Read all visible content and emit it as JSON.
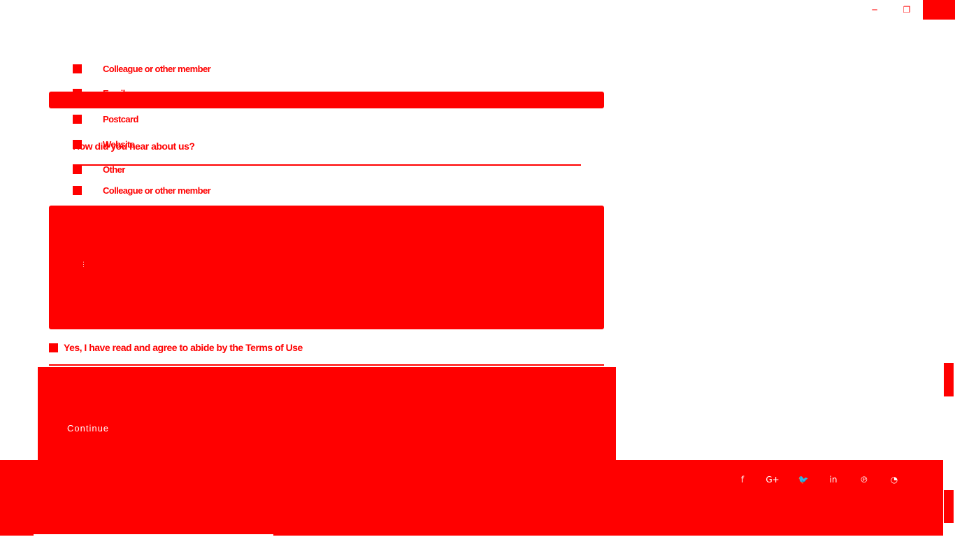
{
  "window": {
    "minimize_glyph": "─",
    "restore_glyph": "❐"
  },
  "referral_options_top": [
    {
      "label": "Colleague or other member"
    },
    {
      "label": "Email"
    },
    {
      "label": "Postcard"
    },
    {
      "label": "Website"
    },
    {
      "label": "Other"
    },
    {
      "label": "Colleague or other member"
    }
  ],
  "question": "How did you hear about us?",
  "textarea_cursor": "⋮",
  "agreement": "Yes, I have read and agree to abide by the Terms of Use",
  "submit_label": "Continue",
  "social": {
    "facebook": "f",
    "google_plus": "G+",
    "twitter": "🐦",
    "linkedin": "in",
    "pinterest": "℗",
    "rss": "◔"
  },
  "colors": {
    "accent": "#ff0000",
    "background": "#ffffff"
  }
}
